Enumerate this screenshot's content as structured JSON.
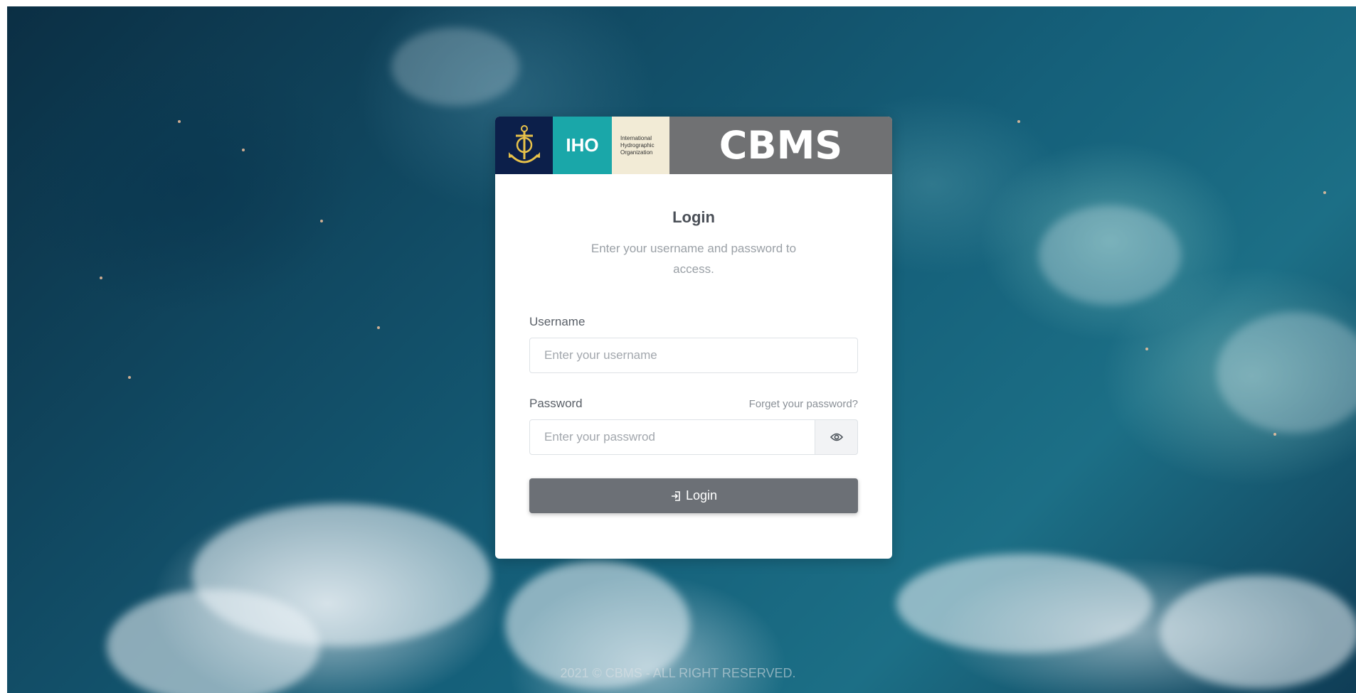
{
  "header": {
    "logo_text": "IHO",
    "org_lines": [
      "International",
      "Hydrographic",
      "Organization"
    ],
    "brand": "CBMS"
  },
  "login": {
    "title": "Login",
    "subtitle": "Enter your username and password to access.",
    "username_label": "Username",
    "username_placeholder": "Enter your username",
    "username_value": "",
    "password_label": "Password",
    "password_placeholder": "Enter your passwrod",
    "password_value": "",
    "forgot_link": "Forget your password?",
    "show_password_icon": "eye-icon",
    "submit_icon": "login-icon",
    "submit_label": "Login"
  },
  "footer": {
    "copyright": "2021 © CBMS - ALL RIGHT RESERVED."
  },
  "colors": {
    "header_navy": "#0c1f4a",
    "header_teal": "#1aa7a9",
    "header_beige": "#f2ebd6",
    "header_gray": "#707173",
    "button_gray": "#6c7076"
  }
}
